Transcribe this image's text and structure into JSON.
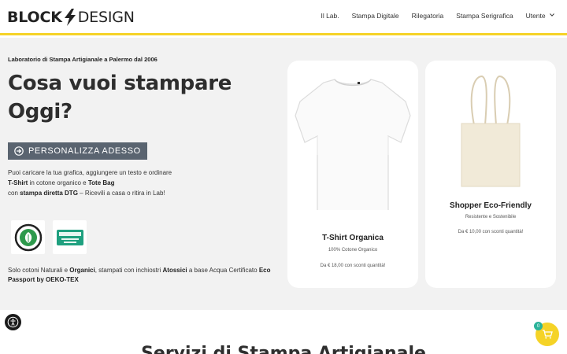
{
  "brand": {
    "part1": "BLOCK",
    "part2": "DESIGN"
  },
  "nav": {
    "items": [
      "Il Lab.",
      "Stampa Digitale",
      "Rilegatoria",
      "Stampa Serigrafica",
      "Utente"
    ]
  },
  "hero": {
    "tagline": "Laboratorio di Stampa Artigianale a Palermo dal 2006",
    "headline": "Cosa vuoi stampare Oggi?",
    "cta_label": "PERSONALIZZA ADESSO",
    "desc": {
      "l1": "Puoi caricare la tua grafica, aggiungere un testo e ordinare",
      "tshirt": "T-Shirt",
      "l2a": " in cotone organico e ",
      "totebag": "Tote Bag",
      "l3a": "con ",
      "dtg": "stampa diretta DTG",
      "l3b": " – Ricevili a casa o ritira in Lab!"
    },
    "bottom": {
      "a": "Solo cotoni Naturali e ",
      "organici": "Organici",
      "b": ", stampati con inchiostri ",
      "atossici": "Atossici",
      "c": " a base Acqua Certificato ",
      "eco": "Eco Passport by OEKO-TEX"
    }
  },
  "products": [
    {
      "title": "T-Shirt Organica",
      "subtitle": "100% Cotone Organico",
      "price": "Da € 18,00 con sconti quantità!"
    },
    {
      "title": "Shopper Eco-Friendly",
      "subtitle": "Resistente e Sostenibile",
      "price": "Da € 10,00 con sconti quantità!"
    }
  ],
  "cart": {
    "count": "0"
  },
  "section_title": "Servizi di Stampa Artigianale",
  "colors": {
    "accent": "#f5d327",
    "cta": "#5a6470",
    "badge": "#2bb39a"
  }
}
